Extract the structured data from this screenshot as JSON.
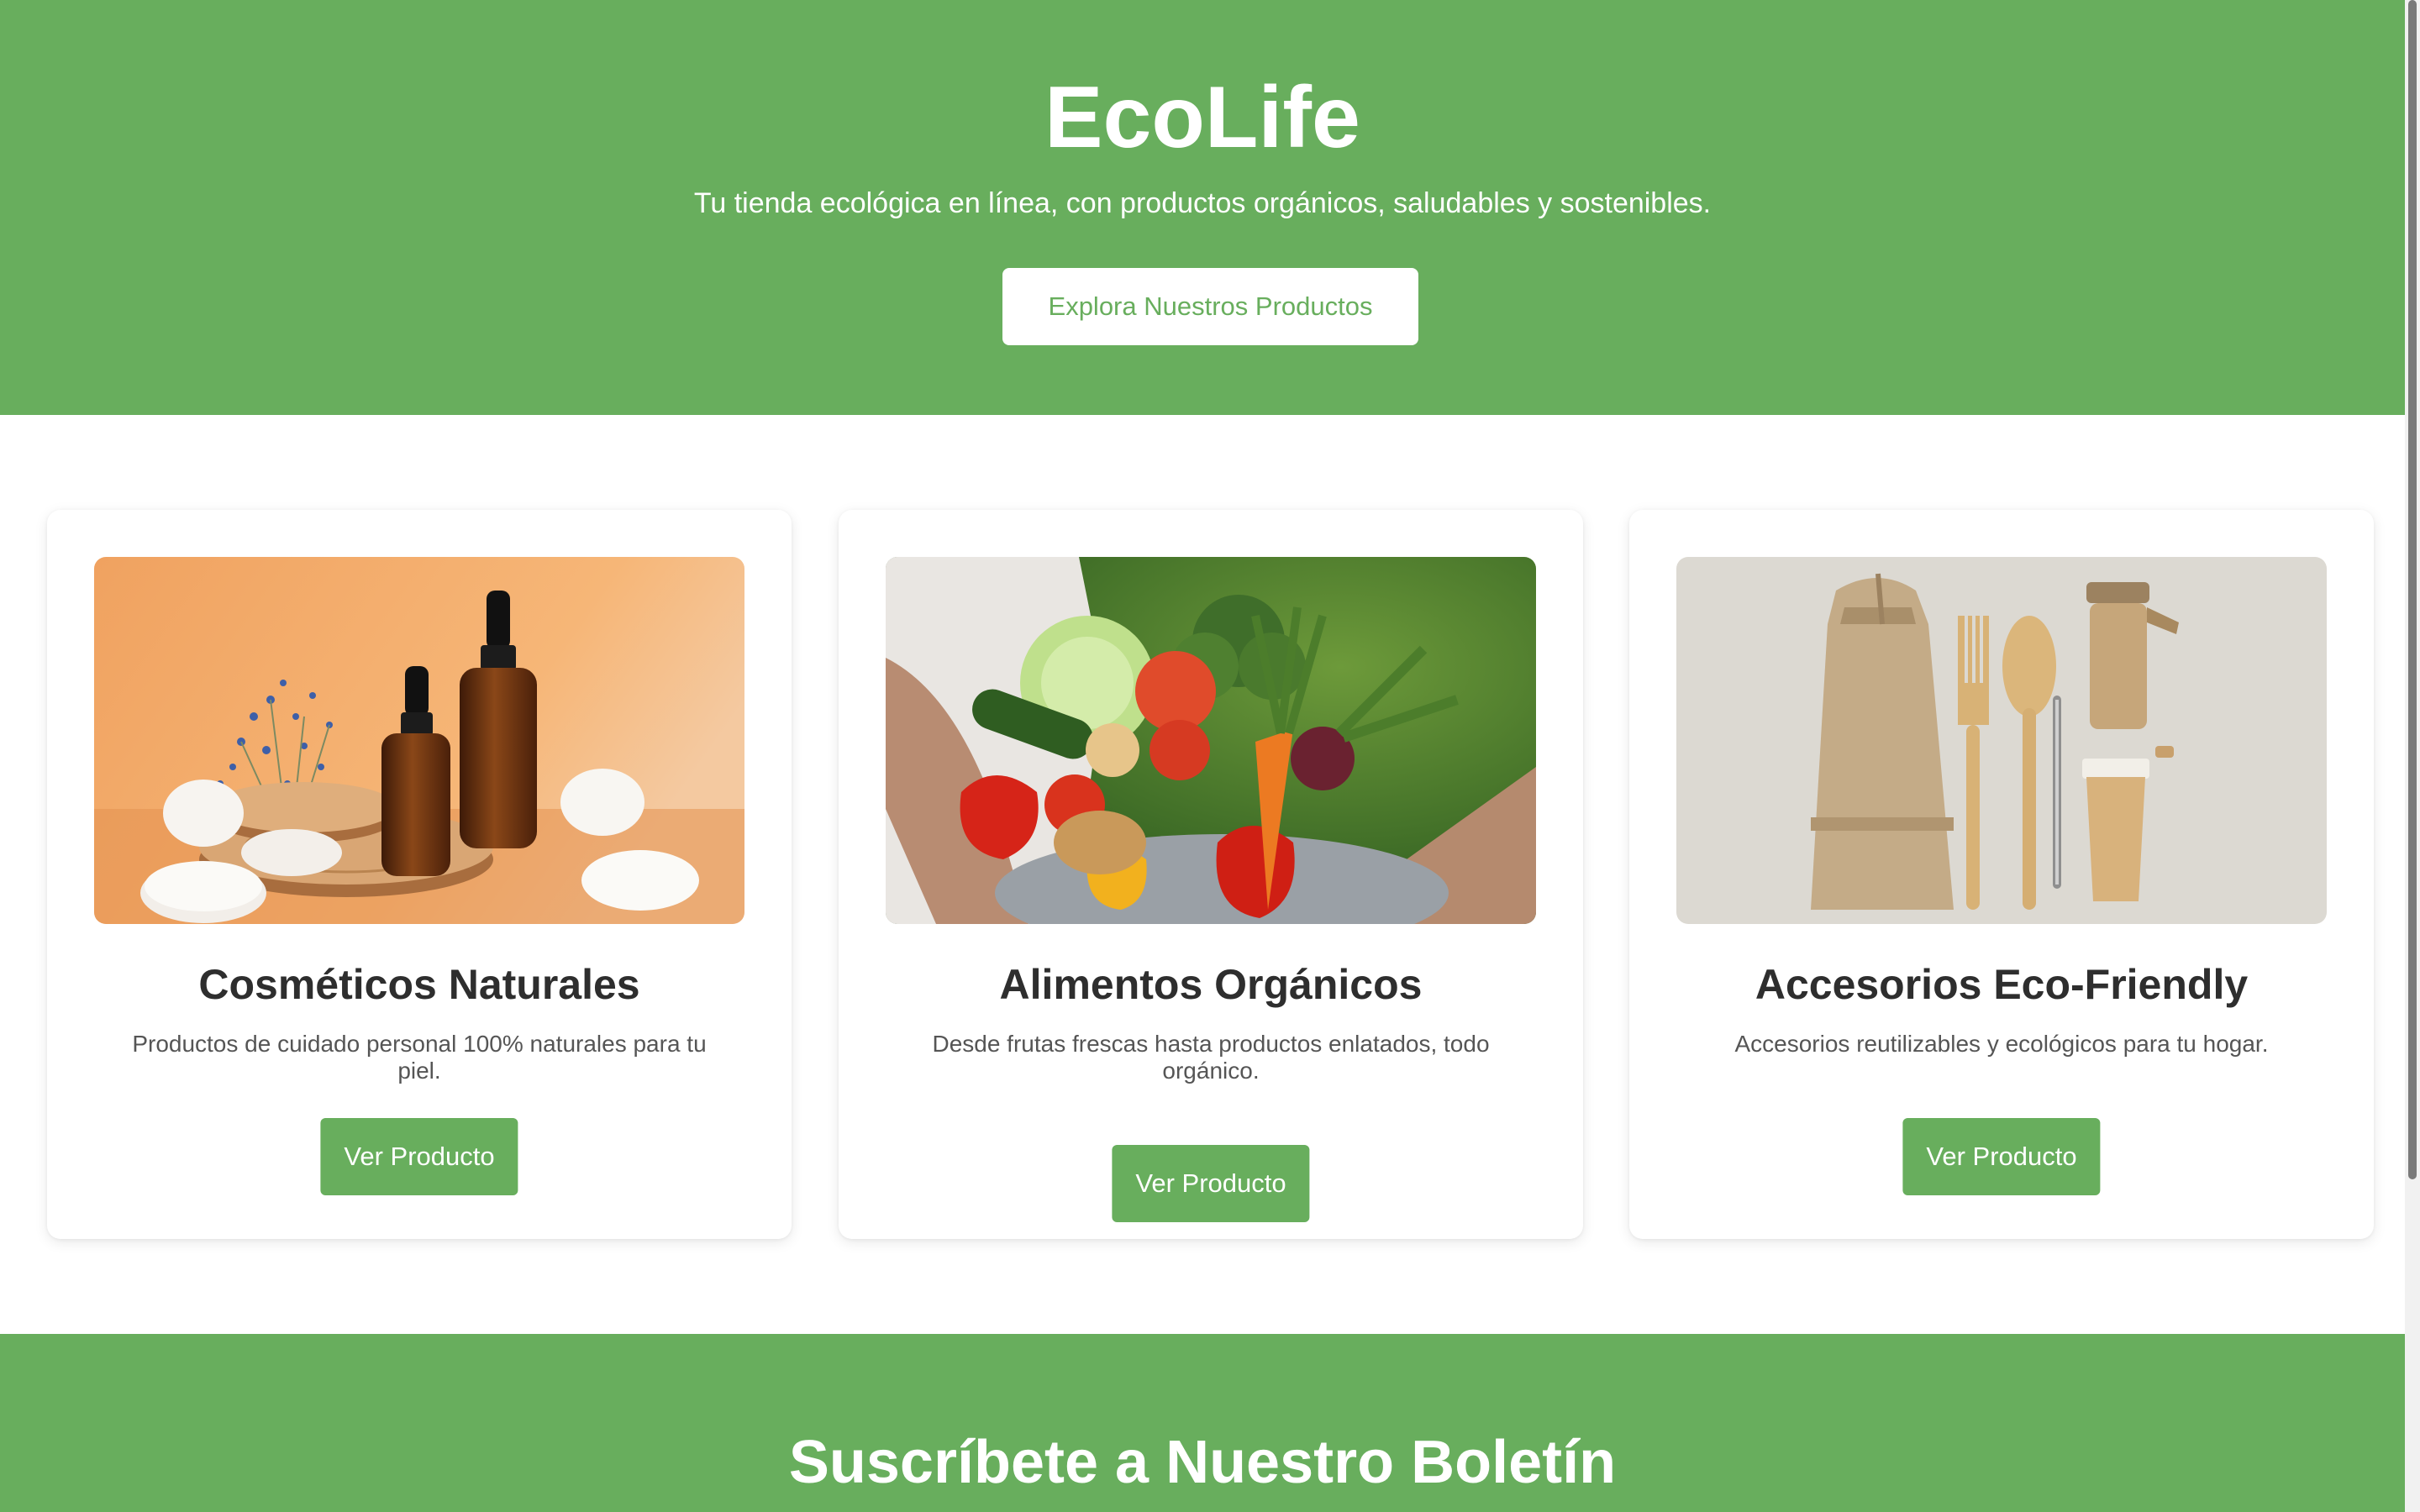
{
  "hero": {
    "title": "EcoLife",
    "subtitle": "Tu tienda ecológica en línea, con productos orgánicos, saludables y sostenibles.",
    "cta_label": "Explora Nuestros Productos"
  },
  "products": [
    {
      "title": "Cosméticos Naturales",
      "description": "Productos de cuidado personal 100% naturales para tu piel.",
      "button_label": "Ver Producto",
      "image_icon": "natural-cosmetics-photo"
    },
    {
      "title": "Alimentos Orgánicos",
      "description": "Desde frutas frescas hasta productos enlatados, todo orgánico.",
      "button_label": "Ver Producto",
      "image_icon": "organic-vegetables-photo"
    },
    {
      "title": "Accesorios Eco-Friendly",
      "description": "Accesorios reutilizables y ecológicos para tu hogar.",
      "button_label": "Ver Producto",
      "image_icon": "eco-accessories-photo"
    }
  ],
  "newsletter": {
    "title": "Suscríbete a Nuestro Boletín"
  },
  "colors": {
    "brand_green": "#68ae5d",
    "heading_text": "#2e2e2e",
    "body_text": "#555555",
    "white": "#ffffff"
  }
}
